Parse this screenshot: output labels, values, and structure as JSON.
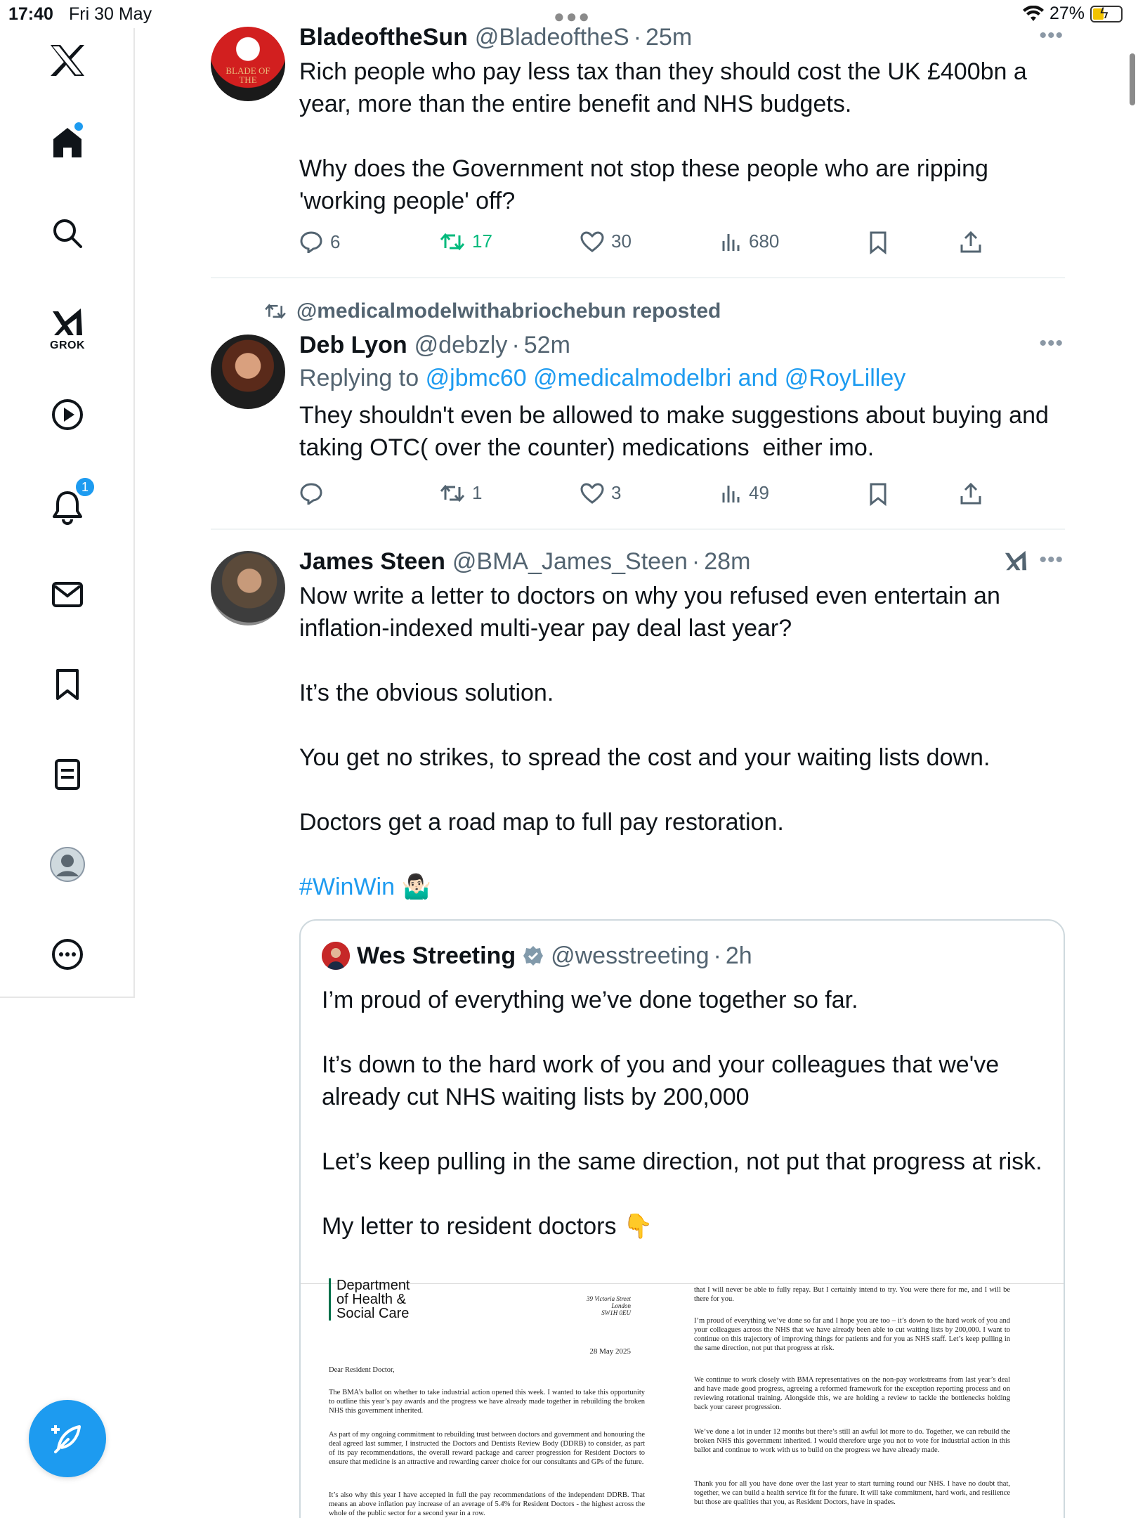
{
  "status_bar": {
    "time": "17:40",
    "date": "Fri 30 May",
    "battery": "27%"
  },
  "sidebar": {
    "grok_label": "GROK",
    "notifications_badge": "1"
  },
  "posts": [
    {
      "name": "BladeoftheSun",
      "handle": "@BladeoftheS",
      "time": "25m",
      "avatar_text": "BLADE OF THE",
      "text": "Rich people who pay less tax than they should cost the UK £400bn a year, more than the entire benefit and NHS budgets.\n\nWhy does the Government not stop these people who are ripping 'working people' off?",
      "replies": "6",
      "reposts": "17",
      "likes": "30",
      "views": "680"
    },
    {
      "repost_by": "@medicalmodelwithabriochebun reposted",
      "name": "Deb Lyon",
      "handle": "@debzly",
      "time": "52m",
      "replying_prefix": "Replying to",
      "mentions": "@jbmc60 @medicalmodelbri and @RoyLilley",
      "text": "They shouldn't even be allowed to make suggestions about buying and taking OTC( over the counter) medications  either imo.",
      "replies": "",
      "reposts": "1",
      "likes": "3",
      "views": "49"
    },
    {
      "name": "James Steen",
      "handle": "@BMA_James_Steen",
      "time": "28m",
      "text": "Now write a letter to doctors on why you refused even entertain an inflation-indexed multi-year pay deal last year?\n\nIt’s the obvious solution.\n\nYou get no strikes, to spread the cost and your waiting lists down.\n\nDoctors get a road map to full pay restoration.",
      "hashtag": "#WinWin 🤷🏻‍♂️"
    }
  ],
  "quote": {
    "name": "Wes Streeting",
    "handle": "@wesstreeting",
    "time": "2h",
    "text": "I’m proud of everything we’ve done together so far.\n\nIt’s down to the hard work of you and your colleagues that we've already cut NHS waiting lists by 200,000\n\nLet’s keep pulling in the same direction, not put that progress at risk.\n\nMy letter to resident doctors 👇",
    "letter": {
      "dept": "Department\nof Health &\nSocial Care",
      "address": "39 Victoria Street\nLondon\nSW1H 0EU",
      "date": "28 May 2025",
      "salutation": "Dear Resident Doctor,",
      "p1": "The BMA’s ballot on whether to take industrial action opened this week. I wanted to take this opportunity to outline this year’s pay awards and the progress we have already made together in rebuilding the broken NHS this government inherited.",
      "p2": "As part of my ongoing commitment to rebuilding trust between doctors and government and honouring the deal agreed last summer, I instructed the Doctors and Dentists Review Body (DDRB) to consider, as part of its pay recommendations, the overall reward package and career progression for Resident Doctors to ensure that medicine is an attractive and rewarding career choice for our consultants and GPs of the future.",
      "p3": "It’s also why this year I have accepted in full the pay recommendations of the independent DDRB. That means an above inflation pay increase of an average of 5.4% for Resident Doctors - the highest across the whole of the public sector for a second year in a row.",
      "r1": "that I will never be able to fully repay. But I certainly intend to try. You were there for me, and I will be there for you.",
      "r2": "I’m proud of everything we’ve done so far and I hope you are too – it’s down to the hard work of you and your colleagues across the NHS that we have already been able to cut waiting lists by 200,000. I want to continue on this trajectory of improving things for patients and for you as NHS staff. Let’s keep pulling in the same direction, not put that progress at risk.",
      "r3": "We continue to work closely with BMA representatives on the non-pay workstreams from last year’s deal and have made good progress, agreeing a reformed framework for the exception reporting process and on reviewing rotational training. Alongside this, we are holding a review to tackle the bottlenecks holding back your career progression.",
      "r4": "We’ve done a lot in under 12 months but there’s still an awful lot more to do. Together, we can rebuild the broken NHS this government inherited. I would therefore urge you not to vote for industrial action in this ballot and continue to work with us to build on the progress we have already made.",
      "r5": "Thank you for all you have done over the last year to start turning round our NHS. I have no doubt that, together, we can build a health service fit for the future. It will take commitment, hard work, and resilience but those are qualities that you, as Resident Doctors, have in spades."
    }
  },
  "colors": {
    "accent": "#1d9bf0",
    "repost_green": "#00ba7c",
    "muted": "#536471"
  }
}
